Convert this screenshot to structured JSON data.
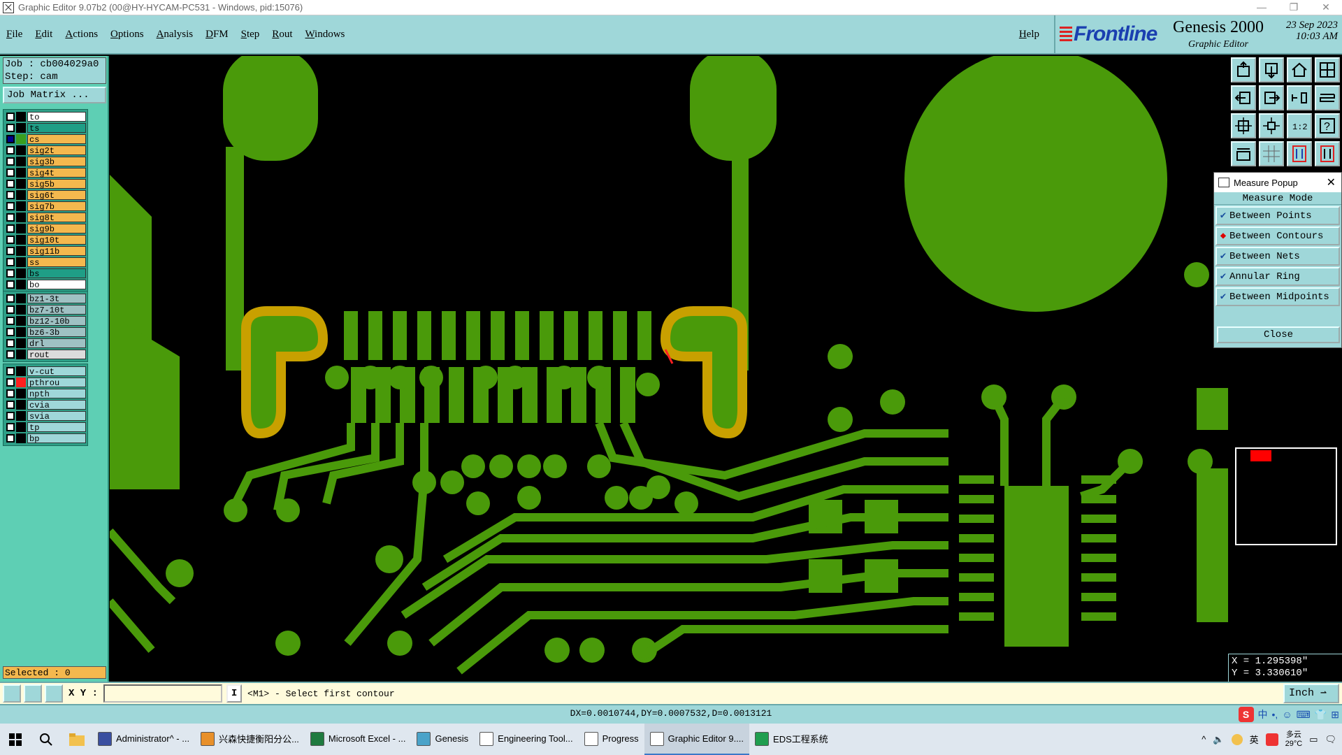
{
  "window": {
    "title": "Graphic Editor 9.07b2 (00@HY-HYCAM-PC531 - Windows, pid:15076)",
    "controls": [
      "—",
      "❐",
      "✕"
    ]
  },
  "menu": {
    "items": [
      "File",
      "Edit",
      "Actions",
      "Options",
      "Analysis",
      "DFM",
      "Step",
      "Rout",
      "Windows"
    ],
    "help": "Help"
  },
  "logo": {
    "brand": "Frontline",
    "product": "Genesis 2000",
    "subtitle": "Graphic Editor",
    "date_line1": "23 Sep 2023",
    "date_line2": "10:03 AM"
  },
  "job": {
    "job_line": "Job : cb004029a0",
    "step_line": "Step: cam",
    "matrix_button": "Job Matrix ..."
  },
  "layers": {
    "group1": [
      {
        "name": "to",
        "color": "#ffffff",
        "swatch": "#000000",
        "selected": false
      },
      {
        "name": "ts",
        "color": "#1f9e86",
        "swatch": "#000000",
        "selected": false
      },
      {
        "name": "cs",
        "color": "#f4b84e",
        "swatch": "#3a9f1f",
        "selected": true
      },
      {
        "name": "sig2t",
        "color": "#f4b84e",
        "swatch": "#000000",
        "selected": false
      },
      {
        "name": "sig3b",
        "color": "#f4b84e",
        "swatch": "#000000",
        "selected": false
      },
      {
        "name": "sig4t",
        "color": "#f4b84e",
        "swatch": "#000000",
        "selected": false
      },
      {
        "name": "sig5b",
        "color": "#f4b84e",
        "swatch": "#000000",
        "selected": false
      },
      {
        "name": "sig6t",
        "color": "#f4b84e",
        "swatch": "#000000",
        "selected": false
      },
      {
        "name": "sig7b",
        "color": "#f4b84e",
        "swatch": "#000000",
        "selected": false
      },
      {
        "name": "sig8t",
        "color": "#f4b84e",
        "swatch": "#000000",
        "selected": false
      },
      {
        "name": "sig9b",
        "color": "#f4b84e",
        "swatch": "#000000",
        "selected": false
      },
      {
        "name": "sig10t",
        "color": "#f4b84e",
        "swatch": "#000000",
        "selected": false
      },
      {
        "name": "sig11b",
        "color": "#f4b84e",
        "swatch": "#000000",
        "selected": false
      },
      {
        "name": "ss",
        "color": "#f4b84e",
        "swatch": "#000000",
        "selected": false
      },
      {
        "name": "bs",
        "color": "#1f9e86",
        "swatch": "#000000",
        "selected": false
      },
      {
        "name": "bo",
        "color": "#ffffff",
        "swatch": "#000000",
        "selected": false
      }
    ],
    "group2": [
      {
        "name": "bz1-3t",
        "color": "#9fc1c3",
        "swatch": "#000000",
        "selected": false
      },
      {
        "name": "bz7-10t",
        "color": "#9fc1c3",
        "swatch": "#000000",
        "selected": false
      },
      {
        "name": "bz12-10b",
        "color": "#9fc1c3",
        "swatch": "#000000",
        "selected": false
      },
      {
        "name": "bz6-3b",
        "color": "#9fc1c3",
        "swatch": "#000000",
        "selected": false
      },
      {
        "name": "drl",
        "color": "#9fc1c3",
        "swatch": "#000000",
        "selected": false
      },
      {
        "name": "rout",
        "color": "#dcdcdc",
        "swatch": "#000000",
        "selected": false
      }
    ],
    "group3": [
      {
        "name": "v-cut",
        "color": "#9fd7d9",
        "swatch": "#000000",
        "selected": false
      },
      {
        "name": "pthrou",
        "color": "#9fd7d9",
        "swatch": "#ff2020",
        "selected": false
      },
      {
        "name": "npth",
        "color": "#9fd7d9",
        "swatch": "#000000",
        "selected": false
      },
      {
        "name": "cvia",
        "color": "#9fd7d9",
        "swatch": "#000000",
        "selected": false
      },
      {
        "name": "svia",
        "color": "#9fd7d9",
        "swatch": "#000000",
        "selected": false
      },
      {
        "name": "tp",
        "color": "#9fd7d9",
        "swatch": "#000000",
        "selected": false
      },
      {
        "name": "bp",
        "color": "#9fd7d9",
        "swatch": "#000000",
        "selected": false
      }
    ]
  },
  "selected_label": "Selected : 0",
  "measure": {
    "title": "Measure Popup",
    "close_x": "✕",
    "mode_title": "Measure Mode",
    "options": [
      {
        "label": "Between Points",
        "active": false
      },
      {
        "label": "Between Contours",
        "active": true
      },
      {
        "label": "Between Nets",
        "active": false
      },
      {
        "label": "Annular Ring",
        "active": false
      },
      {
        "label": "Between Midpoints",
        "active": false
      }
    ],
    "close_label": "Close"
  },
  "coords": {
    "x": "X = 1.295398\"",
    "y": "Y = 3.330610\""
  },
  "command": {
    "xy_label": "X Y :",
    "xy_value": "",
    "info_label": "I",
    "prompt": "<M1> - Select first contour",
    "unit": "Inch ⇀"
  },
  "status": {
    "readout": "DX=0.0010744,DY=0.0007532,D=0.0013121",
    "ime_items": [
      "中",
      "•,",
      "☺",
      "⌨",
      "👕",
      "⊞"
    ]
  },
  "taskbar": {
    "tasks": [
      {
        "label": "Administrator^ - ...",
        "color": "#3a4fa0",
        "active": false
      },
      {
        "label": "兴森快捷衡阳分公...",
        "color": "#e8902a",
        "active": false
      },
      {
        "label": "Microsoft Excel - ...",
        "color": "#1f7a3f",
        "active": false
      },
      {
        "label": "Genesis",
        "color": "#4aa3c9",
        "active": false
      },
      {
        "label": "Engineering Tool...",
        "color": "#ffffff",
        "active": false
      },
      {
        "label": "Progress",
        "color": "#ffffff",
        "active": false
      },
      {
        "label": "Graphic Editor 9....",
        "color": "#ffffff",
        "active": true
      },
      {
        "label": "EDS工程系统",
        "color": "#1f9e4f",
        "active": false
      }
    ],
    "tray": {
      "lang": "英",
      "weather_line1": "多云",
      "weather_line2": "29°C"
    }
  },
  "colors": {
    "copper": "#4a9a0a",
    "highlight": "#c8a000",
    "panel": "#9fd7d9",
    "layer_panel": "#5ecfb4"
  }
}
